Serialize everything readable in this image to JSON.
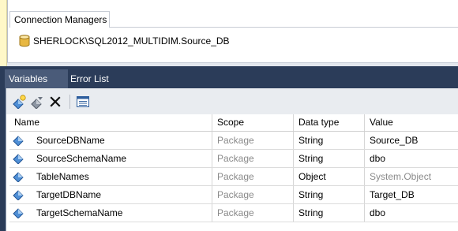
{
  "connection_managers": {
    "tab_label": "Connection Managers",
    "items": [
      {
        "label": "SHERLOCK\\SQL2012_MULTIDIM.Source_DB",
        "icon": "database-icon"
      }
    ]
  },
  "tool_tabs": [
    {
      "label": "Variables",
      "active": true
    },
    {
      "label": "Error List",
      "active": false
    }
  ],
  "toolbar": {
    "buttons": [
      {
        "icon": "add-variable-icon"
      },
      {
        "icon": "move-variable-icon"
      },
      {
        "icon": "delete-icon"
      },
      {
        "icon": "grid-options-icon"
      }
    ]
  },
  "grid": {
    "columns": [
      "Name",
      "Scope",
      "Data type",
      "Value"
    ],
    "rows": [
      {
        "name": "SourceDBName",
        "scope": "Package",
        "type": "String",
        "value": "Source_DB"
      },
      {
        "name": "SourceSchemaName",
        "scope": "Package",
        "type": "String",
        "value": "dbo"
      },
      {
        "name": "TableNames",
        "scope": "Package",
        "type": "Object",
        "value": "System.Object"
      },
      {
        "name": "TargetDBName",
        "scope": "Package",
        "type": "String",
        "value": "Target_DB"
      },
      {
        "name": "TargetSchemaName",
        "scope": "Package",
        "type": "String",
        "value": "dbo"
      }
    ]
  },
  "colors": {
    "frame": "#2b3c59",
    "active_tab": "#4a5b79",
    "muted_text": "#8a8a8a"
  }
}
